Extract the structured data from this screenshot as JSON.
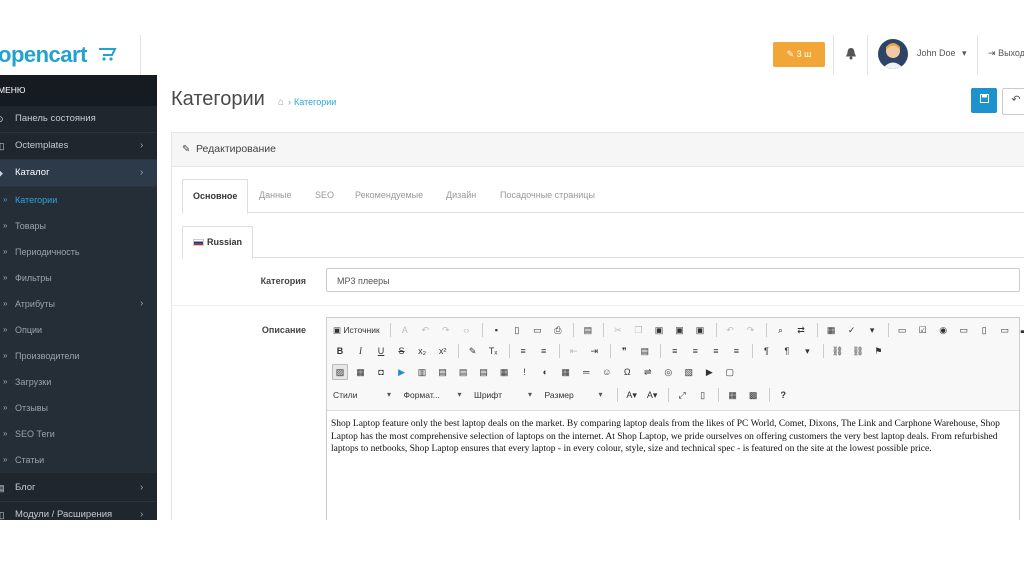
{
  "header": {
    "logo": "opencart",
    "alert_label": "3 ш",
    "username": "John Doe",
    "logout_label": "Выход"
  },
  "sidebar": {
    "menu_title": "МЕНЮ",
    "items": [
      {
        "label": "Панель состояния",
        "icon": "dashboard-icon"
      },
      {
        "label": "Octemplates",
        "icon": "puzzle-icon"
      },
      {
        "label": "Каталог",
        "icon": "tag-icon"
      }
    ],
    "catalog_sub": [
      {
        "label": "Категории"
      },
      {
        "label": "Товары"
      },
      {
        "label": "Периодичность"
      },
      {
        "label": "Фильтры"
      },
      {
        "label": "Атрибуты"
      },
      {
        "label": "Опции"
      },
      {
        "label": "Производители"
      },
      {
        "label": "Загрузки"
      },
      {
        "label": "Отзывы"
      },
      {
        "label": "SEO Теги"
      },
      {
        "label": "Статьи"
      }
    ],
    "bottom_items": [
      {
        "label": "Блог"
      },
      {
        "label": "Модули / Расширения"
      }
    ]
  },
  "page": {
    "title": "Категории",
    "breadcrumb": "Категории",
    "panel_title": "Редактирование"
  },
  "tabs": [
    "Основное",
    "Данные",
    "SEO",
    "Рекомендуемые",
    "Дизайн",
    "Посадочные страницы"
  ],
  "language_tab": "Russian",
  "form": {
    "category_label": "Категория",
    "category_value": "MP3 плееры",
    "description_label": "Описание"
  },
  "editor": {
    "source_label": "Источник",
    "styles_label": "Стили",
    "format_label": "Формат...",
    "font_label": "Шрифт",
    "size_label": "Размер",
    "content": "Shop Laptop feature only the best laptop deals on the market. By comparing laptop deals from the likes of PC World, Comet, Dixons, The Link and Carphone Warehouse, Shop Laptop has the most comprehensive selection of laptops on the internet. At Shop Laptop, we pride ourselves on offering customers the very best laptop deals. From refurbished laptops to netbooks, Shop Laptop ensures that every laptop - in every colour, style, size and technical spec - is featured on the site at the lowest possible price."
  },
  "colors": {
    "sidebar_bg": "#1f262d",
    "accent": "#1e91cf",
    "alert": "#f3a638",
    "link": "#2aa7e0"
  }
}
